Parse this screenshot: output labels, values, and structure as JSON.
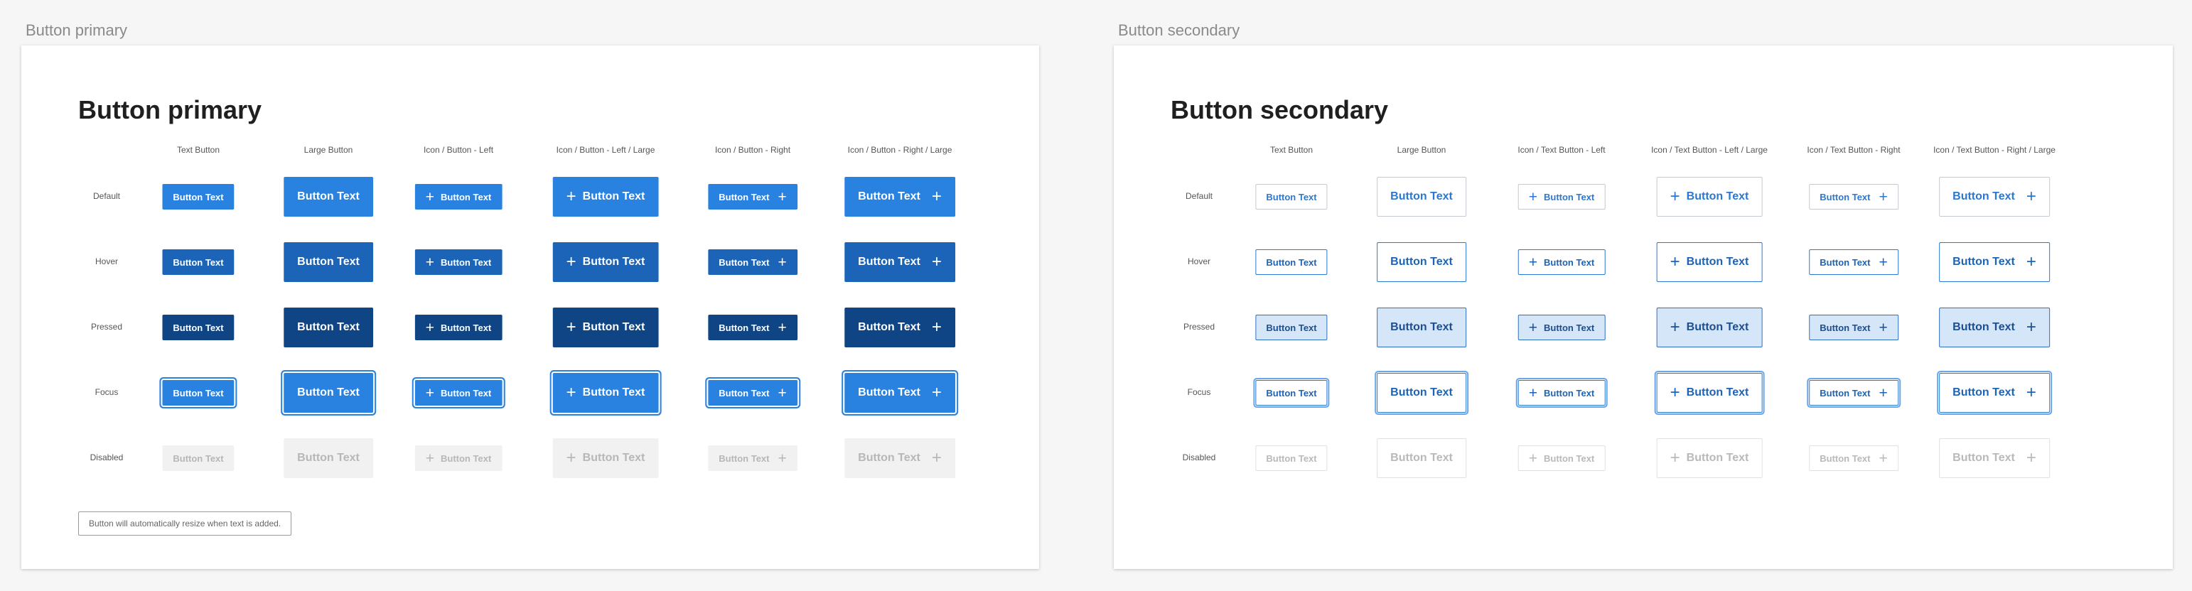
{
  "primary": {
    "artboard_label": "Button primary",
    "title": "Button primary",
    "note": "Button will automatically resize when text is added.",
    "columns": [
      {
        "header": "Text Button",
        "size": "small",
        "icon": "none"
      },
      {
        "header": "Large Button",
        "size": "large",
        "icon": "none"
      },
      {
        "header": "Icon / Button - Left",
        "size": "small",
        "icon": "left"
      },
      {
        "header": "Icon / Button - Left / Large",
        "size": "large",
        "icon": "left"
      },
      {
        "header": "Icon / Button - Right",
        "size": "small",
        "icon": "right"
      },
      {
        "header": "Icon / Button - Right / Large",
        "size": "large",
        "icon": "right"
      }
    ]
  },
  "secondary": {
    "artboard_label": "Button secondary",
    "title": "Button secondary",
    "columns": [
      {
        "header": "Text Button",
        "size": "small",
        "icon": "none"
      },
      {
        "header": "Large Button",
        "size": "large",
        "icon": "none"
      },
      {
        "header": "Icon / Text Button - Left",
        "size": "small",
        "icon": "left"
      },
      {
        "header": "Icon / Text Button - Left / Large",
        "size": "large",
        "icon": "left"
      },
      {
        "header": "Icon / Text Button - Right",
        "size": "small",
        "icon": "right"
      },
      {
        "header": "Icon / Text Button - Right / Large",
        "size": "large",
        "icon": "right"
      }
    ]
  },
  "states": [
    "Default",
    "Hover",
    "Pressed",
    "Focus",
    "Disabled"
  ],
  "button_text": "Button Text",
  "plus_glyph": "+",
  "icon_name": "plus-icon",
  "colors": {
    "primary_default": "#2a82e0",
    "primary_hover": "#1b64b8",
    "primary_pressed": "#0f4584",
    "primary_disabled_bg": "#f1f1f1",
    "secondary_text": "#2a78d2",
    "secondary_pressed_bg": "#d6e6f9"
  }
}
